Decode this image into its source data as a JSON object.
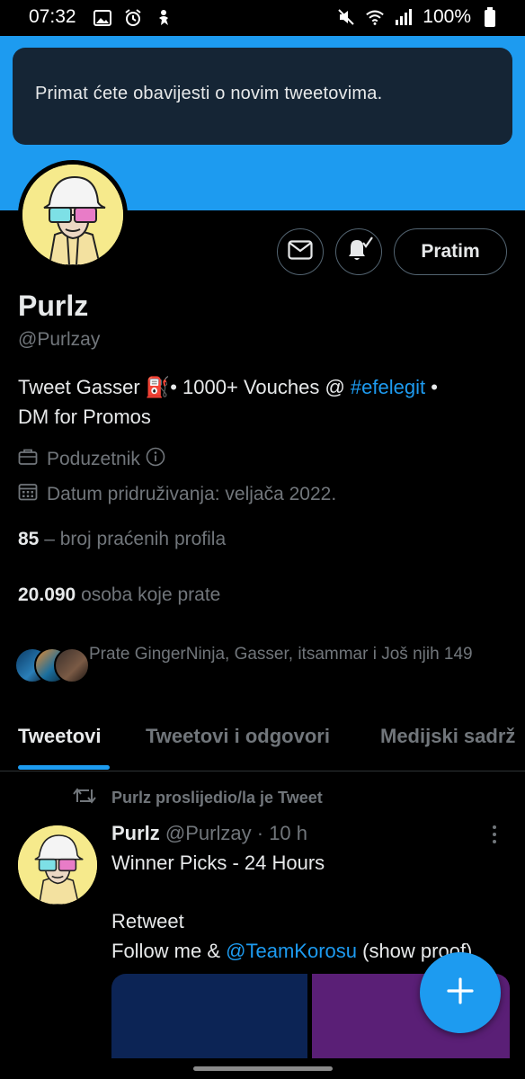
{
  "status_bar": {
    "time": "07:32",
    "battery": "100%",
    "left_icons": [
      "gallery-icon",
      "alarm-icon",
      "accessibility-icon"
    ],
    "right_icons": [
      "mute-icon",
      "wifi-icon",
      "signal-icon",
      "battery-icon"
    ]
  },
  "toast": {
    "message": "Primat ćete obavijesti o novim tweetovima."
  },
  "profile": {
    "name": "Purlz",
    "handle": "@Purlzay",
    "bio_text": "Tweet Gasser ⛽• 1000+ Vouches @ ",
    "bio_hashtag": "#efelegit",
    "bio_suffix": " •",
    "bio_line2": "DM for Promos",
    "profession": "Poduzetnik",
    "joined": "Datum pridruživanja: veljača 2022.",
    "following_count": "85",
    "following_label": " – broj praćenih profila",
    "followers_count": "20.090",
    "followers_label": " osoba koje prate",
    "followed_by": "Prate GingerNinja, Gasser, itsammar i Još njih 149"
  },
  "actions": {
    "follow_label": "Pratim"
  },
  "tabs": [
    {
      "label": "Tweetovi",
      "active": true
    },
    {
      "label": "Tweetovi i odgovori",
      "active": false
    },
    {
      "label": "Medijski sadrž",
      "active": false
    }
  ],
  "tweet": {
    "retweet_label": "Purlz proslijedio/la je Tweet",
    "author_name": "Purlz",
    "author_handle": "@Purlzay",
    "time_sep": " · ",
    "time": "10 h",
    "line1": "Winner Picks - 24 Hours",
    "line2": "Retweet",
    "line3_prefix": "Follow me & ",
    "line3_mention": "@TeamKorosu",
    "line3_suffix": " (show proof)"
  },
  "colors": {
    "accent": "#1d9bf0",
    "background": "#000000",
    "toast_bg": "#152535",
    "muted_text": "#71767b"
  }
}
